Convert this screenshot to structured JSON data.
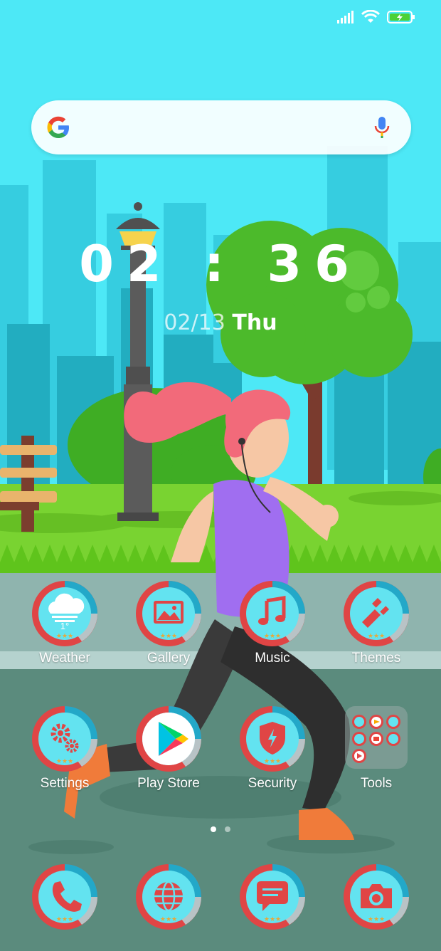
{
  "status_bar": {
    "signal_icon": "signal-bars-icon",
    "wifi_icon": "wifi-icon",
    "battery_icon": "battery-charging-icon"
  },
  "search": {
    "placeholder": "",
    "logo": "google-g-icon",
    "voice_icon": "microphone-icon"
  },
  "clock": {
    "time": "02 : 36",
    "date": "02/13",
    "weekday": "Thu"
  },
  "weather": {
    "temperature": "1°"
  },
  "apps_row1": [
    {
      "label": "Weather",
      "icon": "weather-cloud-icon"
    },
    {
      "label": "Gallery",
      "icon": "image-icon"
    },
    {
      "label": "Music",
      "icon": "music-note-icon"
    },
    {
      "label": "Themes",
      "icon": "paintbrush-icon"
    }
  ],
  "apps_row2": [
    {
      "label": "Settings",
      "icon": "gears-icon"
    },
    {
      "label": "Play Store",
      "icon": "play-store-icon"
    },
    {
      "label": "Security",
      "icon": "shield-bolt-icon"
    },
    {
      "label": "Tools",
      "icon": "folder-icon"
    }
  ],
  "dock": [
    {
      "icon": "phone-icon"
    },
    {
      "icon": "globe-icon"
    },
    {
      "icon": "message-icon"
    },
    {
      "icon": "camera-icon"
    }
  ],
  "page_indicator": {
    "pages": 2,
    "current": 1
  },
  "colors": {
    "sky": "#4de8f6",
    "icon_ring_red": "#e04545",
    "icon_ring_blue": "#23a8c8",
    "icon_face": "#63e3f0",
    "grass": "#79d331"
  }
}
